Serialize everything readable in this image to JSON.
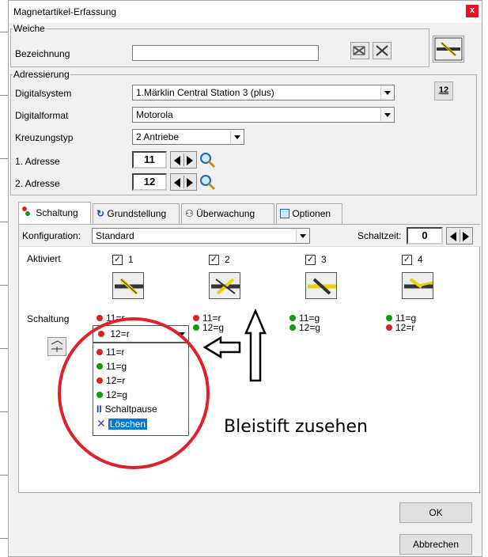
{
  "window": {
    "title": "Magnetartikel-Erfassung",
    "close_label": "x"
  },
  "weiche": {
    "group_label": "Weiche",
    "bezeichnung_label": "Bezeichnung",
    "bezeichnung_value": ""
  },
  "adressierung": {
    "group_label": "Adressierung",
    "digitalsystem_label": "Digitalsystem",
    "digitalsystem_value": "1.Märklin Central Station 3 (plus)",
    "digitalformat_label": "Digitalformat",
    "digitalformat_value": "Motorola",
    "kreuzungstyp_label": "Kreuzungstyp",
    "kreuzungstyp_value": "2 Antriebe",
    "adresse1_label": "1. Adresse",
    "adresse1_value": "11",
    "adresse2_label": "2. Adresse",
    "adresse2_value": "12",
    "count_button_label": "12"
  },
  "tabs": [
    {
      "label": "Schaltung",
      "icon": "signal-icon"
    },
    {
      "label": "Grundstellung",
      "icon": "reset-icon"
    },
    {
      "label": "Überwachung",
      "icon": "binoculars-icon"
    },
    {
      "label": "Optionen",
      "icon": "options-icon"
    }
  ],
  "schaltung": {
    "konfiguration_label": "Konfiguration:",
    "konfiguration_value": "Standard",
    "schaltzeit_label": "Schaltzeit:",
    "schaltzeit_value": "0",
    "aktiviert_label": "Aktiviert",
    "schaltung_label": "Schaltung",
    "columns": [
      {
        "num": "1",
        "checked": true,
        "states": [
          {
            "text": "11=r",
            "color": "r"
          },
          {
            "text": "12=r",
            "color": "r"
          }
        ]
      },
      {
        "num": "2",
        "checked": true,
        "states": [
          {
            "text": "11=r",
            "color": "r"
          },
          {
            "text": "12=g",
            "color": "g"
          }
        ]
      },
      {
        "num": "3",
        "checked": true,
        "states": [
          {
            "text": "11=g",
            "color": "g"
          },
          {
            "text": "12=g",
            "color": "g"
          }
        ]
      },
      {
        "num": "4",
        "checked": true,
        "states": [
          {
            "text": "11=g",
            "color": "g"
          },
          {
            "text": "12=r",
            "color": "r"
          }
        ]
      }
    ],
    "dropdown_selected": "12=r",
    "dropdown_options": [
      {
        "text": "11=r",
        "kind": "r"
      },
      {
        "text": "11=g",
        "kind": "g"
      },
      {
        "text": "12=r",
        "kind": "r"
      },
      {
        "text": "12=g",
        "kind": "g"
      },
      {
        "text": "Schaltpause",
        "kind": "pause"
      },
      {
        "text": "Löschen",
        "kind": "delete"
      }
    ]
  },
  "annotation": {
    "text": "Bleistift zusehen",
    "color": "#e0202a"
  },
  "buttons": {
    "ok": "OK",
    "cancel": "Abbrechen"
  }
}
